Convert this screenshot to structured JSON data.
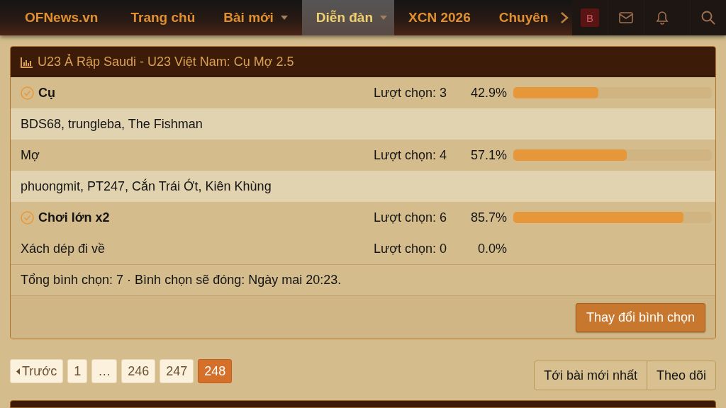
{
  "nav": {
    "logo": "OFNews.vn",
    "items": [
      {
        "label": "Trang chủ",
        "selected": false,
        "dropdown": false
      },
      {
        "label": "Bài mới",
        "selected": false,
        "dropdown": true
      },
      {
        "label": "Diễn đàn",
        "selected": true,
        "dropdown": true
      },
      {
        "label": "XCN 2026",
        "selected": false,
        "dropdown": false
      },
      {
        "label": "Chuyên",
        "selected": false,
        "dropdown": false
      }
    ],
    "avatar": "B"
  },
  "poll": {
    "title": "U23 Ả Rập Saudi - U23 Việt Nam: Cụ Mợ 2.5",
    "rows": [
      {
        "kind": "option",
        "label": "Cụ",
        "voted": true,
        "votes": "Lượt chọn: 3",
        "percent": "42.9%",
        "level": 0.429
      },
      {
        "kind": "voters",
        "label": "BDS68, trungleba, The Fishman"
      },
      {
        "kind": "option",
        "label": "Mợ",
        "voted": false,
        "votes": "Lượt chọn: 4",
        "percent": "57.1%",
        "level": 0.571
      },
      {
        "kind": "voters",
        "label": "phuongmit, PT247, Cắn Trái Ớt, Kiên Khùng"
      },
      {
        "kind": "option",
        "label": "Chơi lớn x2",
        "voted": true,
        "votes": "Lượt chọn: 6",
        "percent": "85.7%",
        "level": 0.857
      },
      {
        "kind": "option",
        "label": "Xách dép đi về",
        "voted": false,
        "votes": "Lượt chọn: 0",
        "percent": "0.0%"
      }
    ],
    "summary": "Tổng bình chọn: 7 · Bình chọn sẽ đóng: Ngày mai 20:23.",
    "button": "Thay đổi bình chọn"
  },
  "pager": {
    "prev": "Trước",
    "pages": [
      {
        "label": "1",
        "selected": false
      },
      {
        "label": "…",
        "selected": false
      },
      {
        "label": "246",
        "selected": false
      },
      {
        "label": "247",
        "selected": false
      },
      {
        "label": "248",
        "selected": true
      }
    ],
    "actions": [
      "Tới bài mới nhất",
      "Theo dõi"
    ]
  }
}
